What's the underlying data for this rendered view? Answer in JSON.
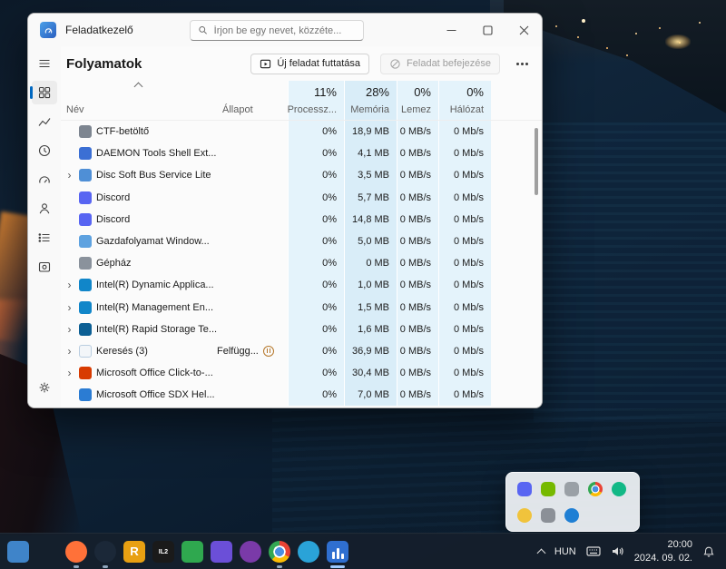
{
  "window": {
    "title": "Feladatkezelő",
    "search": {
      "placeholder": "Írjon be egy nevet, közzéte..."
    },
    "page_title": "Folyamatok",
    "toolbar": {
      "run_new_task": "Új feladat futtatása",
      "end_task": "Feladat befejezése"
    },
    "summary": {
      "cpu": "11%",
      "mem": "28%",
      "disk": "0%",
      "net": "0%"
    },
    "columns": {
      "name": "Név",
      "status": "Állapot",
      "cpu": "Processz...",
      "mem": "Memória",
      "disk": "Lemez",
      "net": "Hálózat"
    },
    "processes": [
      {
        "name": "CTF-betöltő",
        "expand": false,
        "status": "",
        "suspended": false,
        "cpu": "0%",
        "mem": "18,9 MB",
        "disk": "0 MB/s",
        "net": "0 Mb/s",
        "icon": "#7d8590"
      },
      {
        "name": "DAEMON Tools Shell Ext...",
        "expand": false,
        "status": "",
        "suspended": false,
        "cpu": "0%",
        "mem": "4,1 MB",
        "disk": "0 MB/s",
        "net": "0 Mb/s",
        "icon": "#3b6fd4"
      },
      {
        "name": "Disc Soft Bus Service Lite",
        "expand": true,
        "status": "",
        "suspended": false,
        "cpu": "0%",
        "mem": "3,5 MB",
        "disk": "0 MB/s",
        "net": "0 Mb/s",
        "icon": "#4f8fd6"
      },
      {
        "name": "Discord",
        "expand": false,
        "status": "",
        "suspended": false,
        "cpu": "0%",
        "mem": "5,7 MB",
        "disk": "0 MB/s",
        "net": "0 Mb/s",
        "icon": "#5865f2"
      },
      {
        "name": "Discord",
        "expand": false,
        "status": "",
        "suspended": false,
        "cpu": "0%",
        "mem": "14,8 MB",
        "disk": "0 MB/s",
        "net": "0 Mb/s",
        "icon": "#5865f2"
      },
      {
        "name": "Gazdafolyamat Window...",
        "expand": false,
        "status": "",
        "suspended": false,
        "cpu": "0%",
        "mem": "5,0 MB",
        "disk": "0 MB/s",
        "net": "0 Mb/s",
        "icon": "#5ea2e0"
      },
      {
        "name": "Gépház",
        "expand": false,
        "status": "",
        "suspended": false,
        "cpu": "0%",
        "mem": "0 MB",
        "disk": "0 MB/s",
        "net": "0 Mb/s",
        "icon": "#8a929c"
      },
      {
        "name": "Intel(R) Dynamic Applica...",
        "expand": true,
        "status": "",
        "suspended": false,
        "cpu": "0%",
        "mem": "1,0 MB",
        "disk": "0 MB/s",
        "net": "0 Mb/s",
        "icon": "#1186c9"
      },
      {
        "name": "Intel(R) Management En...",
        "expand": true,
        "status": "",
        "suspended": false,
        "cpu": "0%",
        "mem": "1,5 MB",
        "disk": "0 MB/s",
        "net": "0 Mb/s",
        "icon": "#1186c9"
      },
      {
        "name": "Intel(R) Rapid Storage Te...",
        "expand": true,
        "status": "",
        "suspended": false,
        "cpu": "0%",
        "mem": "1,6 MB",
        "disk": "0 MB/s",
        "net": "0 Mb/s",
        "icon": "#0c5f94"
      },
      {
        "name": "Keresés (3)",
        "expand": true,
        "status": "Felfügg...",
        "suspended": true,
        "cpu": "0%",
        "mem": "36,9 MB",
        "disk": "0 MB/s",
        "net": "0 Mb/s",
        "icon": "#f3f6f9",
        "border": "#b9cde0"
      },
      {
        "name": "Microsoft Office Click-to-...",
        "expand": true,
        "status": "",
        "suspended": false,
        "cpu": "0%",
        "mem": "30,4 MB",
        "disk": "0 MB/s",
        "net": "0 Mb/s",
        "icon": "#d83b01"
      },
      {
        "name": "Microsoft Office SDX Hel...",
        "expand": false,
        "status": "",
        "suspended": false,
        "cpu": "0%",
        "mem": "7,0 MB",
        "disk": "0 MB/s",
        "net": "0 Mb/s",
        "icon": "#2b7cd3"
      }
    ]
  },
  "tray_flyout": {
    "icons": [
      {
        "name": "discord-tray-icon",
        "type": "square",
        "color": "#5865f2"
      },
      {
        "name": "nvidia-tray-icon",
        "type": "square",
        "color": "#76b900"
      },
      {
        "name": "gray-app-tray-icon",
        "type": "square",
        "color": "#9aa0a6"
      },
      {
        "name": "chrome-tray-icon",
        "type": "chrome",
        "color": ""
      },
      {
        "name": "teal-app-tray-icon",
        "type": "circle",
        "color": "#12b886"
      },
      {
        "name": "daemon-tray-icon",
        "type": "circle",
        "color": "#f0c33c"
      },
      {
        "name": "gray-app2-tray-icon",
        "type": "square",
        "color": "#8b9097"
      },
      {
        "name": "blue-app-tray-icon",
        "type": "circle",
        "color": "#1f7fd4"
      }
    ]
  },
  "taskbar": {
    "apps": [
      {
        "name": "display-app-icon",
        "type": "square",
        "color": "#3f84c9",
        "glyph": "",
        "open": false,
        "focused": false
      },
      {
        "name": "windows-start-icon",
        "type": "start",
        "color": "#4cb5f5",
        "glyph": "",
        "open": false,
        "focused": false
      },
      {
        "name": "firefox-icon",
        "type": "circle",
        "color": "#ff7139",
        "glyph": "",
        "open": true,
        "focused": false
      },
      {
        "name": "steam-icon",
        "type": "circle",
        "color": "#1b2838",
        "glyph": "",
        "open": true,
        "focused": false
      },
      {
        "name": "runelite-icon",
        "type": "square",
        "color": "#e8a012",
        "glyph": "R",
        "open": false,
        "focused": false
      },
      {
        "name": "il2-game-icon",
        "type": "square",
        "color": "#1a1a1a",
        "glyph": "IL2",
        "open": false,
        "focused": false
      },
      {
        "name": "green-app-icon",
        "type": "square",
        "color": "#2fa84f",
        "glyph": "",
        "open": false,
        "focused": false
      },
      {
        "name": "purple-app-icon",
        "type": "square",
        "color": "#6b4fd8",
        "glyph": "",
        "open": false,
        "focused": false
      },
      {
        "name": "violet-app-icon",
        "type": "circle",
        "color": "#7a3aa8",
        "glyph": "",
        "open": false,
        "focused": false
      },
      {
        "name": "chrome-icon",
        "type": "chrome",
        "color": "",
        "glyph": "",
        "open": true,
        "focused": false
      },
      {
        "name": "blue-media-app-icon",
        "type": "circle",
        "color": "#2aa3d8",
        "glyph": "",
        "open": false,
        "focused": false
      },
      {
        "name": "task-manager-icon",
        "type": "taskmgr",
        "color": "#2f6fd0",
        "glyph": "",
        "open": true,
        "focused": true
      }
    ],
    "tray": {
      "language": "HUN",
      "time": "20:00",
      "date": "2024. 09. 02."
    }
  }
}
